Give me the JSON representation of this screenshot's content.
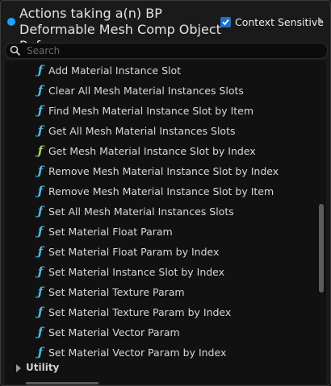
{
  "header": {
    "title": "Actions taking a(n) BP Deformable Mesh Comp Object Reference",
    "context_sensitive_label": "Context Sensitive",
    "context_sensitive_checked": true
  },
  "search": {
    "placeholder": "Search",
    "value": ""
  },
  "function_icon_glyph": "ƒ",
  "colors": {
    "accent": "#1fa0ff",
    "function_icon": "#4fb8e8",
    "function_icon_pure": "#9ed860",
    "checkbox": "#1f6fc9"
  },
  "actions": [
    {
      "label": "Add Material Instance Slot",
      "icon": "function-icon"
    },
    {
      "label": "Clear All Mesh Material Instances Slots",
      "icon": "function-icon"
    },
    {
      "label": "Find Mesh Material Instance Slot by Item",
      "icon": "function-icon"
    },
    {
      "label": "Get All Mesh Material Instances Slots",
      "icon": "function-icon"
    },
    {
      "label": "Get Mesh Material Instance Slot by Index",
      "icon": "pure-function-icon"
    },
    {
      "label": "Remove Mesh Material Instance Slot by Index",
      "icon": "function-icon"
    },
    {
      "label": "Remove Mesh Material Instance Slot by Item",
      "icon": "function-icon"
    },
    {
      "label": "Set All Mesh Material Instances Slots",
      "icon": "function-icon"
    },
    {
      "label": "Set Material Float Param",
      "icon": "function-icon"
    },
    {
      "label": "Set Material Float Param by Index",
      "icon": "function-icon"
    },
    {
      "label": "Set Material Instance Slot by Index",
      "icon": "function-icon"
    },
    {
      "label": "Set Material Texture Param",
      "icon": "function-icon"
    },
    {
      "label": "Set Material Texture Param by Index",
      "icon": "function-icon"
    },
    {
      "label": "Set Material Vector Param",
      "icon": "function-icon"
    },
    {
      "label": "Set Material Vector Param by Index",
      "icon": "function-icon"
    }
  ],
  "categories": [
    {
      "label": "Utility",
      "expanded": false
    }
  ]
}
